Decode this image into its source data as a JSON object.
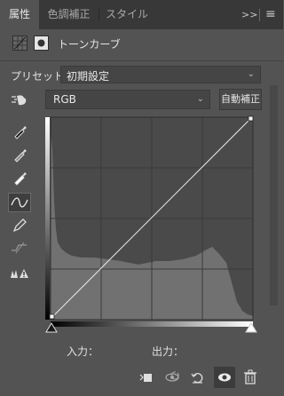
{
  "tabs": [
    {
      "label": "属性",
      "active": true
    },
    {
      "label": "色調補正",
      "active": false
    },
    {
      "label": "スタイル",
      "active": false
    }
  ],
  "tabbar_icons": {
    "expand": ">>",
    "menu": "≡"
  },
  "header": {
    "title": "トーンカーブ",
    "icons": [
      "curves-adjustment-icon",
      "layer-mask-icon"
    ]
  },
  "preset": {
    "label": "プリセット：",
    "value": "初期設定"
  },
  "channel": {
    "value": "RGB"
  },
  "auto_button": {
    "label": "自動補正"
  },
  "tools": [
    "on-image-adjust-icon",
    "black-point-eyedropper-icon",
    "gray-point-eyedropper-icon",
    "white-point-eyedropper-icon",
    "curve-edit-icon",
    "pencil-icon",
    "smooth-curve-icon",
    "clipping-warning-icon"
  ],
  "io": {
    "input_label": "入力：",
    "output_label": "出力："
  },
  "bottom_icons": [
    "clip-to-layer-icon",
    "view-previous-state-icon",
    "reset-icon",
    "visibility-eye-icon",
    "trash-icon"
  ],
  "colors": {
    "panel_bg": "#535353",
    "graph_bg": "#4a4a4a",
    "histogram": "#6e6e6e",
    "curve": "#e8e8e8"
  }
}
